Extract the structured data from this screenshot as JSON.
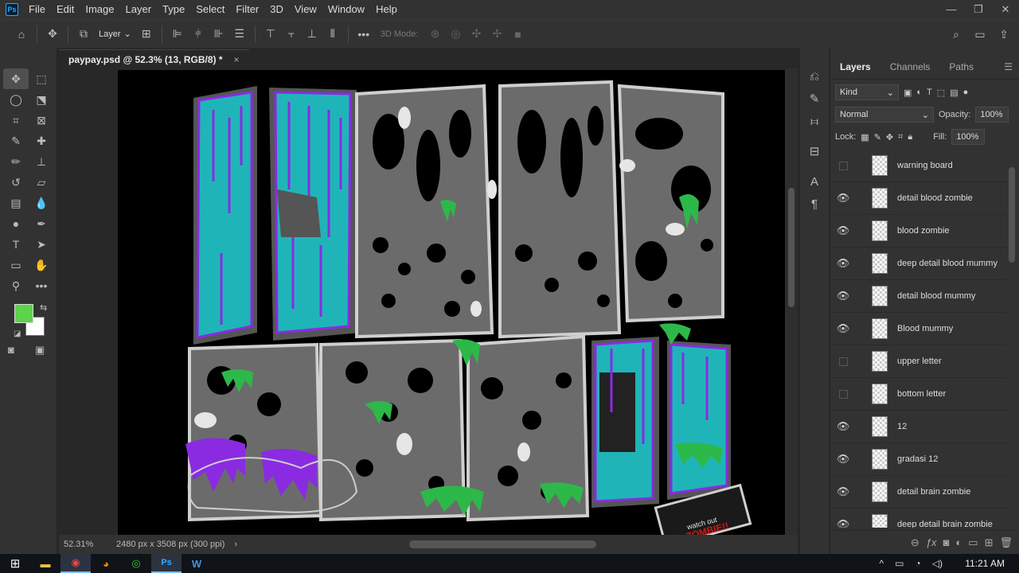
{
  "app": {
    "logo": "Ps",
    "menu": [
      "File",
      "Edit",
      "Image",
      "Layer",
      "Type",
      "Select",
      "Filter",
      "3D",
      "View",
      "Window",
      "Help"
    ]
  },
  "window_controls": {
    "minimize": "—",
    "restore": "❐",
    "close": "✕"
  },
  "options": {
    "auto_select_target": "Layer",
    "three_d_mode": "3D Mode:"
  },
  "document": {
    "tab_title": "paypay.psd @ 52.3% (13, RGB/8) *",
    "close": "×"
  },
  "status": {
    "zoom": "52.31%",
    "doc_info": "2480 px x 3508 px (300 ppi)",
    "arrow": "›"
  },
  "layers_panel": {
    "tabs": [
      "Layers",
      "Channels",
      "Paths"
    ],
    "filter_kind": "Kind",
    "blend_mode": "Normal",
    "opacity_label": "Opacity:",
    "opacity_value": "100%",
    "lock_label": "Lock:",
    "fill_label": "Fill:",
    "fill_value": "100%",
    "layers": [
      {
        "name": "warning board",
        "visible": false
      },
      {
        "name": "detail blood zombie",
        "visible": true
      },
      {
        "name": "blood zombie",
        "visible": true
      },
      {
        "name": "deep detail blood mummy",
        "visible": true
      },
      {
        "name": "detail blood mummy",
        "visible": true
      },
      {
        "name": "Blood mummy",
        "visible": true
      },
      {
        "name": "upper letter",
        "visible": false
      },
      {
        "name": "bottom letter",
        "visible": false
      },
      {
        "name": "12",
        "visible": true
      },
      {
        "name": "gradasi 12",
        "visible": true
      },
      {
        "name": "detail brain zombie",
        "visible": true
      },
      {
        "name": "deep detail brain zombie",
        "visible": true
      }
    ]
  },
  "artwork": {
    "sign_line1": "watch out",
    "sign_line2": "ZOMBIE!!"
  },
  "colors": {
    "foreground": "#5bd34b",
    "background": "#ffffff",
    "teal": "#1fb5b8",
    "purple": "#8a2be2",
    "slime": "#2db84a"
  },
  "taskbar": {
    "time": "11:21 AM",
    "word_icon": "W",
    "ps_icon": "Ps",
    "tray_expand": "^",
    "tray_wifi": "◔"
  }
}
